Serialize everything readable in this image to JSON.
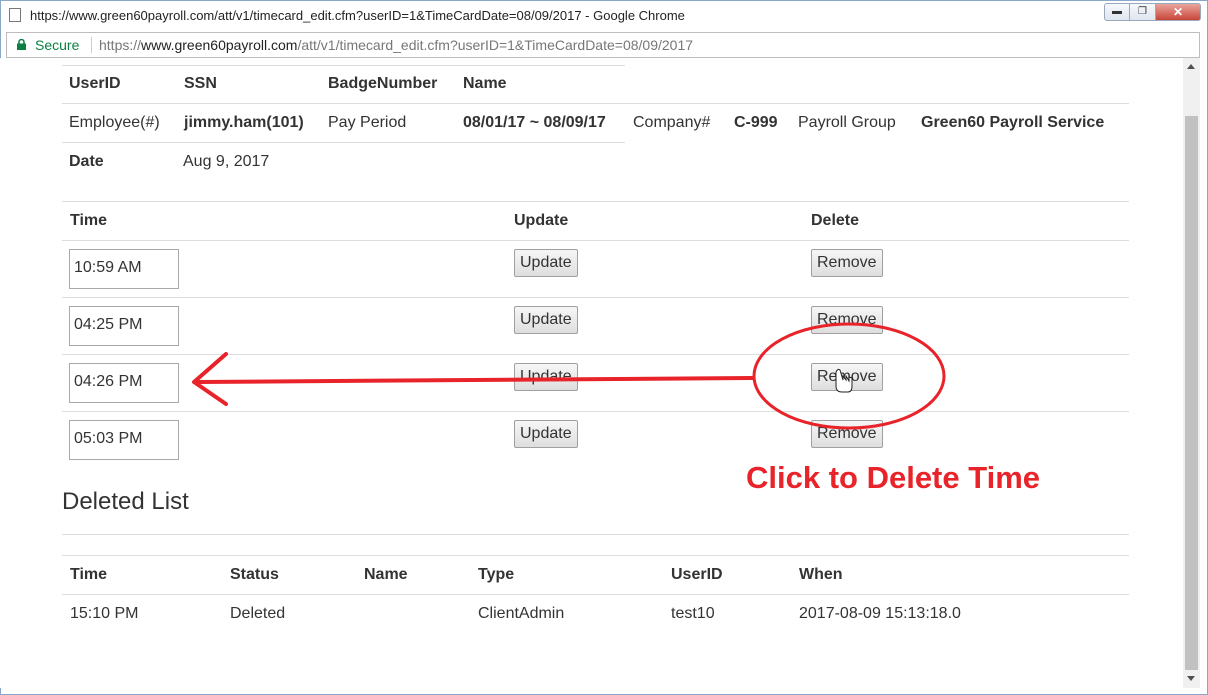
{
  "browser": {
    "window_title": "https://www.green60payroll.com/att/v1/timecard_edit.cfm?userID=1&TimeCardDate=08/09/2017 - Google Chrome",
    "secure_label": "Secure",
    "url_scheme": "https://",
    "url_host": "www.green60payroll.com",
    "url_path": "/att/v1/timecard_edit.cfm?userID=1&TimeCardDate=08/09/2017",
    "window_buttons": {
      "minimize": "▬",
      "maximize": "❐",
      "close": "✕"
    }
  },
  "employee": {
    "headers": {
      "userid": "UserID",
      "ssn": "SSN",
      "badge": "BadgeNumber",
      "name": "Name"
    },
    "employee_label": "Employee(#)",
    "employee_value": "jimmy.ham(101)",
    "pay_period_label": "Pay Period",
    "pay_period_value": "08/01/17 ~ 08/09/17",
    "company_label": "Company#",
    "company_value": "C-999",
    "payroll_group_label": "Payroll Group",
    "payroll_group_value": "Green60 Payroll Service",
    "date_label": "Date",
    "date_value": "Aug 9, 2017"
  },
  "time_table": {
    "headers": {
      "time": "Time",
      "update": "Update",
      "delete": "Delete"
    },
    "rows": [
      {
        "time": "10:59 AM",
        "update": "Update",
        "remove": "Remove"
      },
      {
        "time": "04:25 PM",
        "update": "Update",
        "remove": "Remove"
      },
      {
        "time": "04:26 PM",
        "update": "Update",
        "remove": "Remove"
      },
      {
        "time": "05:03 PM",
        "update": "Update",
        "remove": "Remove"
      }
    ]
  },
  "deleted_list": {
    "title": "Deleted List",
    "headers": {
      "time": "Time",
      "status": "Status",
      "name": "Name",
      "type": "Type",
      "userid": "UserID",
      "when": "When"
    },
    "rows": [
      {
        "time": "15:10 PM",
        "status": "Deleted",
        "name": "",
        "type": "ClientAdmin",
        "userid": "test10",
        "when": "2017-08-09 15:13:18.0"
      }
    ]
  },
  "annotation": {
    "text": "Click to Delete Time",
    "color": "#e8232a"
  }
}
